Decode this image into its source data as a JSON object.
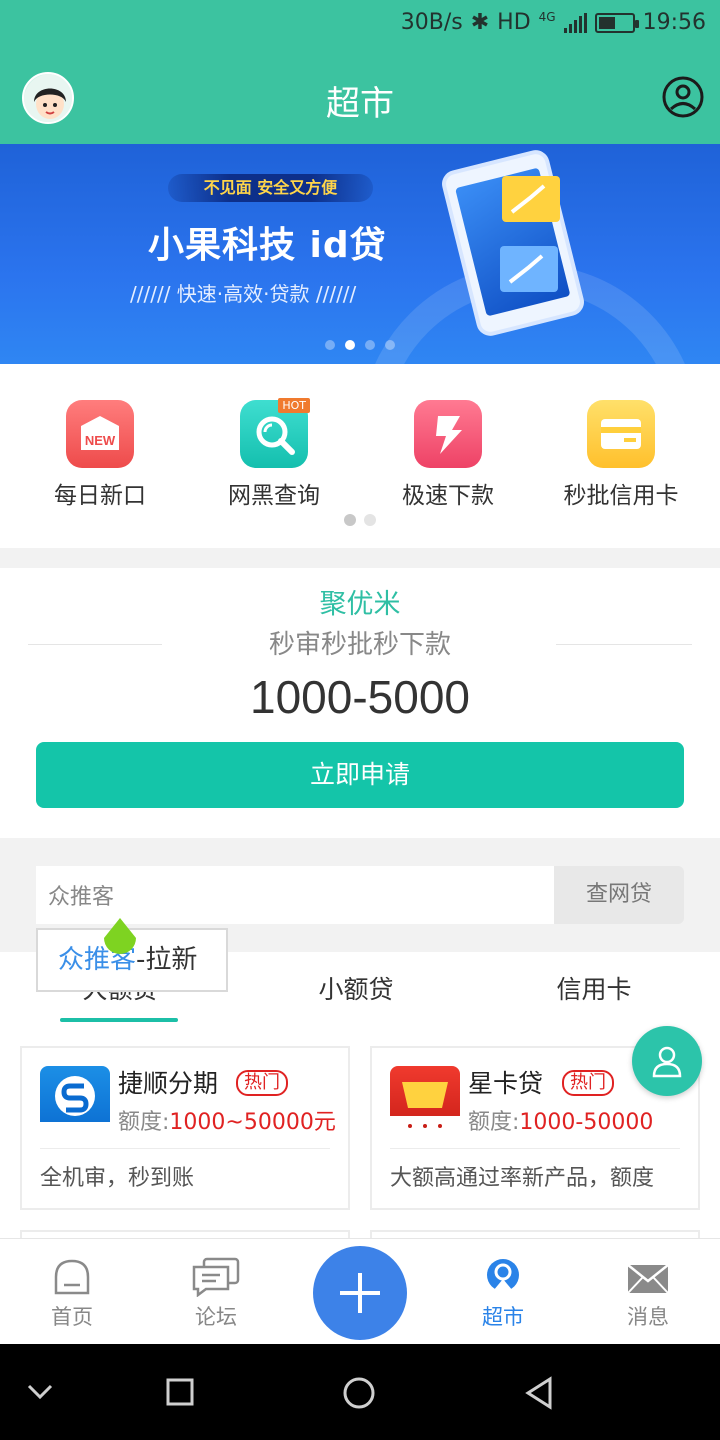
{
  "status_bar": {
    "speed": "30B/s",
    "network": "HD",
    "net_type": "4G",
    "time": "19:56"
  },
  "header": {
    "title": "超市"
  },
  "banner": {
    "tag": "不见面 安全又方便",
    "headline": "小果科技 id贷",
    "subline": "////// 快速·高效·贷款 //////"
  },
  "quick_links": [
    {
      "label": "每日新口",
      "icon": "new-badge-icon",
      "color": "#f25a5a"
    },
    {
      "label": "网黑查询",
      "icon": "magnifier-icon",
      "color": "#22cbbd",
      "badge": "HOT"
    },
    {
      "label": "极速下款",
      "icon": "lightning-icon",
      "color": "#f4577a"
    },
    {
      "label": "秒批信用卡",
      "icon": "card-icon",
      "color": "#ffc93c"
    }
  ],
  "promo": {
    "brand": "聚优米",
    "slogan": "秒审秒批秒下款",
    "amount": "1000-5000",
    "apply_label": "立即申请"
  },
  "search": {
    "value": "众推客",
    "button": "查网贷"
  },
  "tooltip": {
    "highlight": "众推客",
    "rest": "-拉新"
  },
  "tabs": [
    {
      "label": "大额贷"
    },
    {
      "label": "小额贷"
    },
    {
      "label": "信用卡"
    }
  ],
  "products": [
    {
      "name": "捷顺分期",
      "badge": "热门",
      "limit_label": "额度:",
      "limit_value": "1000~50000元",
      "desc": "全机审，秒到账"
    },
    {
      "name": "星卡贷",
      "badge": "热门",
      "limit_label": "额度:",
      "limit_value": "1000-50000",
      "desc": "大额高通过率新产品，额度"
    }
  ],
  "bottom_nav": [
    {
      "label": "首页",
      "icon": "home-icon"
    },
    {
      "label": "论坛",
      "icon": "forum-icon"
    },
    {
      "label": "超市",
      "icon": "market-icon",
      "active": true
    },
    {
      "label": "消息",
      "icon": "mail-icon"
    }
  ],
  "colors": {
    "primary": "#3cc3a0",
    "accent": "#14c5a9",
    "nav_active": "#2a83e8",
    "hot": "#e02222"
  }
}
